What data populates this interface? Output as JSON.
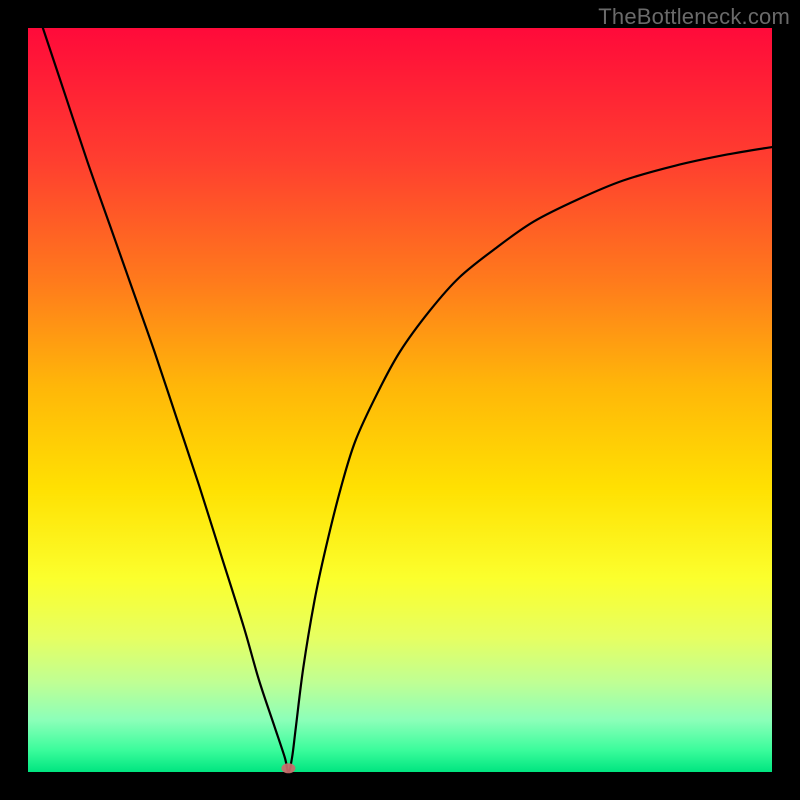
{
  "watermark": "TheBottleneck.com",
  "chart_data": {
    "type": "line",
    "title": "",
    "xlabel": "",
    "ylabel": "",
    "xlim": [
      0,
      100
    ],
    "ylim": [
      0,
      100
    ],
    "grid": false,
    "legend": false,
    "series": [
      {
        "name": "bottleneck-curve",
        "type": "line",
        "x": [
          2,
          5,
          8,
          11,
          14,
          17,
          20,
          23,
          26,
          29,
          31,
          33,
          34.5,
          35,
          35.5,
          36,
          37,
          38.5,
          40,
          42,
          44,
          47,
          50,
          54,
          58,
          63,
          68,
          74,
          80,
          87,
          94,
          100
        ],
        "y": [
          100,
          91,
          82,
          73.5,
          65,
          56.5,
          47.5,
          38.5,
          29,
          19.5,
          12.5,
          6.5,
          2,
          0,
          2,
          6,
          14,
          23,
          30,
          38,
          44.5,
          51,
          56.5,
          62,
          66.5,
          70.5,
          74,
          77,
          79.5,
          81.5,
          83,
          84
        ],
        "color": "#000000"
      },
      {
        "name": "optimum-marker",
        "type": "scatter",
        "x": [
          35
        ],
        "y": [
          0.5
        ],
        "color": "#cc6b6b"
      }
    ],
    "annotations": []
  }
}
